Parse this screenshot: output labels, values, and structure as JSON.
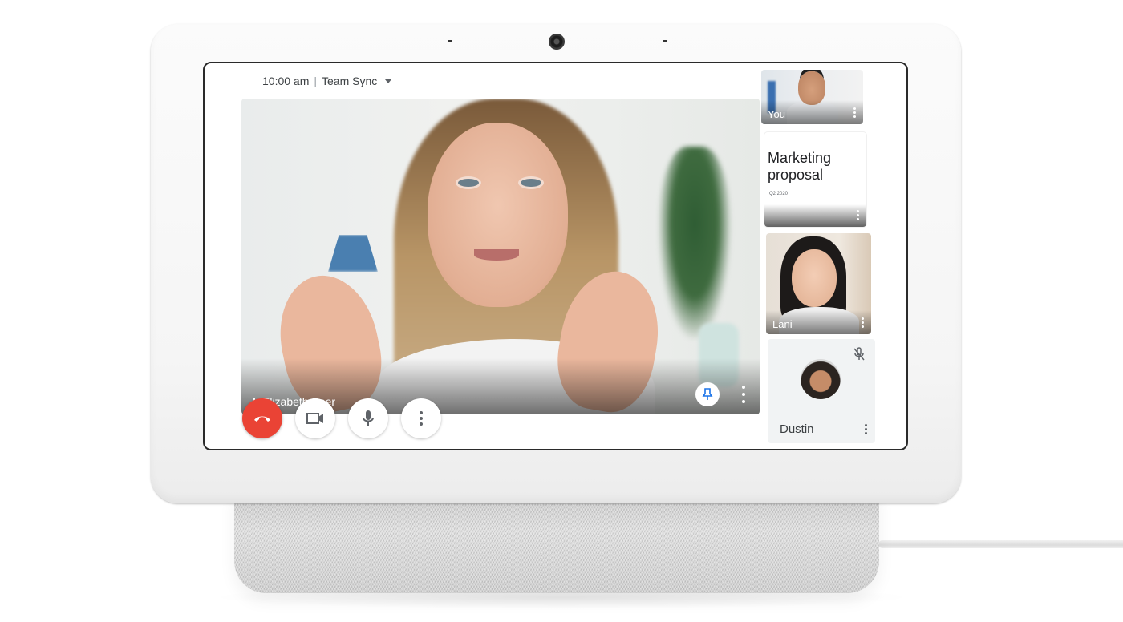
{
  "device": {
    "name": "Smart display with speaker base"
  },
  "header": {
    "time": "10:00 am",
    "separator": "|",
    "meeting_title": "Team Sync"
  },
  "main_video": {
    "participant_name": "Elizabeth Baer",
    "speaking_indicator": "audio-bars-icon",
    "pin_icon": "pin-icon",
    "more_icon": "more-vert-icon"
  },
  "controls": [
    {
      "name": "end-call",
      "icon": "phone-hangup-icon",
      "color": "#ea4335"
    },
    {
      "name": "camera",
      "icon": "video-camera-icon"
    },
    {
      "name": "microphone",
      "icon": "mic-icon"
    },
    {
      "name": "more",
      "icon": "more-vert-icon"
    }
  ],
  "participants": [
    {
      "label": "You",
      "type": "video"
    },
    {
      "label": "Marketing proposal",
      "type": "presentation",
      "subtitle": "Q2 2020"
    },
    {
      "label": "Lani",
      "type": "video"
    },
    {
      "label": "Dustin",
      "type": "avatar",
      "muted": true
    }
  ],
  "colors": {
    "end_call_red": "#ea4335",
    "pin_blue": "#1a73e8",
    "text_dark": "#3c4043"
  }
}
